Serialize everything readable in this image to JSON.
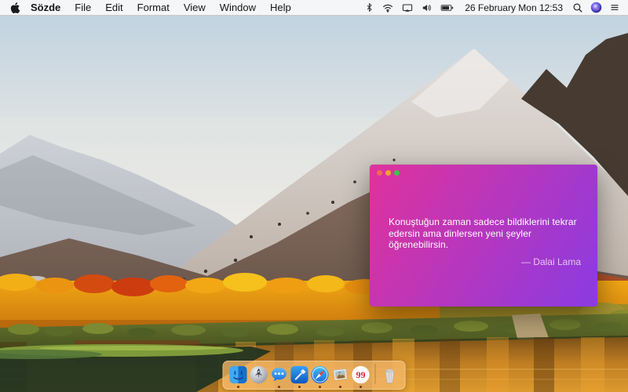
{
  "menu_bar": {
    "apple_icon": "apple-logo",
    "app_name": "Sözde",
    "menus": [
      "File",
      "Edit",
      "Format",
      "View",
      "Window",
      "Help"
    ],
    "status_icons": [
      "bluetooth",
      "wifi",
      "display-mirroring",
      "volume",
      "battery"
    ],
    "clock": "26 February Mon 12:53",
    "right_icons": [
      "spotlight-search",
      "siri",
      "notification-center"
    ]
  },
  "quote_window": {
    "quote": "Konuştuğun zaman sadece bildiklerini tekrar\nedersin ama dinlersen yeni şeyler\nöğrenebilirsin.",
    "attribution": "— Dalai Lama"
  },
  "dock": {
    "apps": [
      {
        "name": "Finder",
        "running": true
      },
      {
        "name": "Launchpad",
        "running": false
      },
      {
        "name": "Messages",
        "running": true
      },
      {
        "name": "Xcode",
        "running": true
      },
      {
        "name": "Safari",
        "running": true
      },
      {
        "name": "Preview",
        "running": true
      },
      {
        "name": "Sözde Quotes",
        "running": true,
        "glyph": "99"
      }
    ],
    "trash": {
      "name": "Trash",
      "state": "full"
    }
  },
  "colors": {
    "quote-grad-start": "#e0329b",
    "quote-grad-end": "#8a3be2",
    "traffic-red": "#f0685a",
    "traffic-yellow": "#f0a32e",
    "traffic-green": "#35c94c",
    "quote-text": "#ffffff",
    "attribution-text": "rgba(255,255,255,0.72)",
    "menubar-bg": "rgba(249,249,249,0.93)",
    "dock-bg": "rgba(243,183,105,0.78)"
  }
}
